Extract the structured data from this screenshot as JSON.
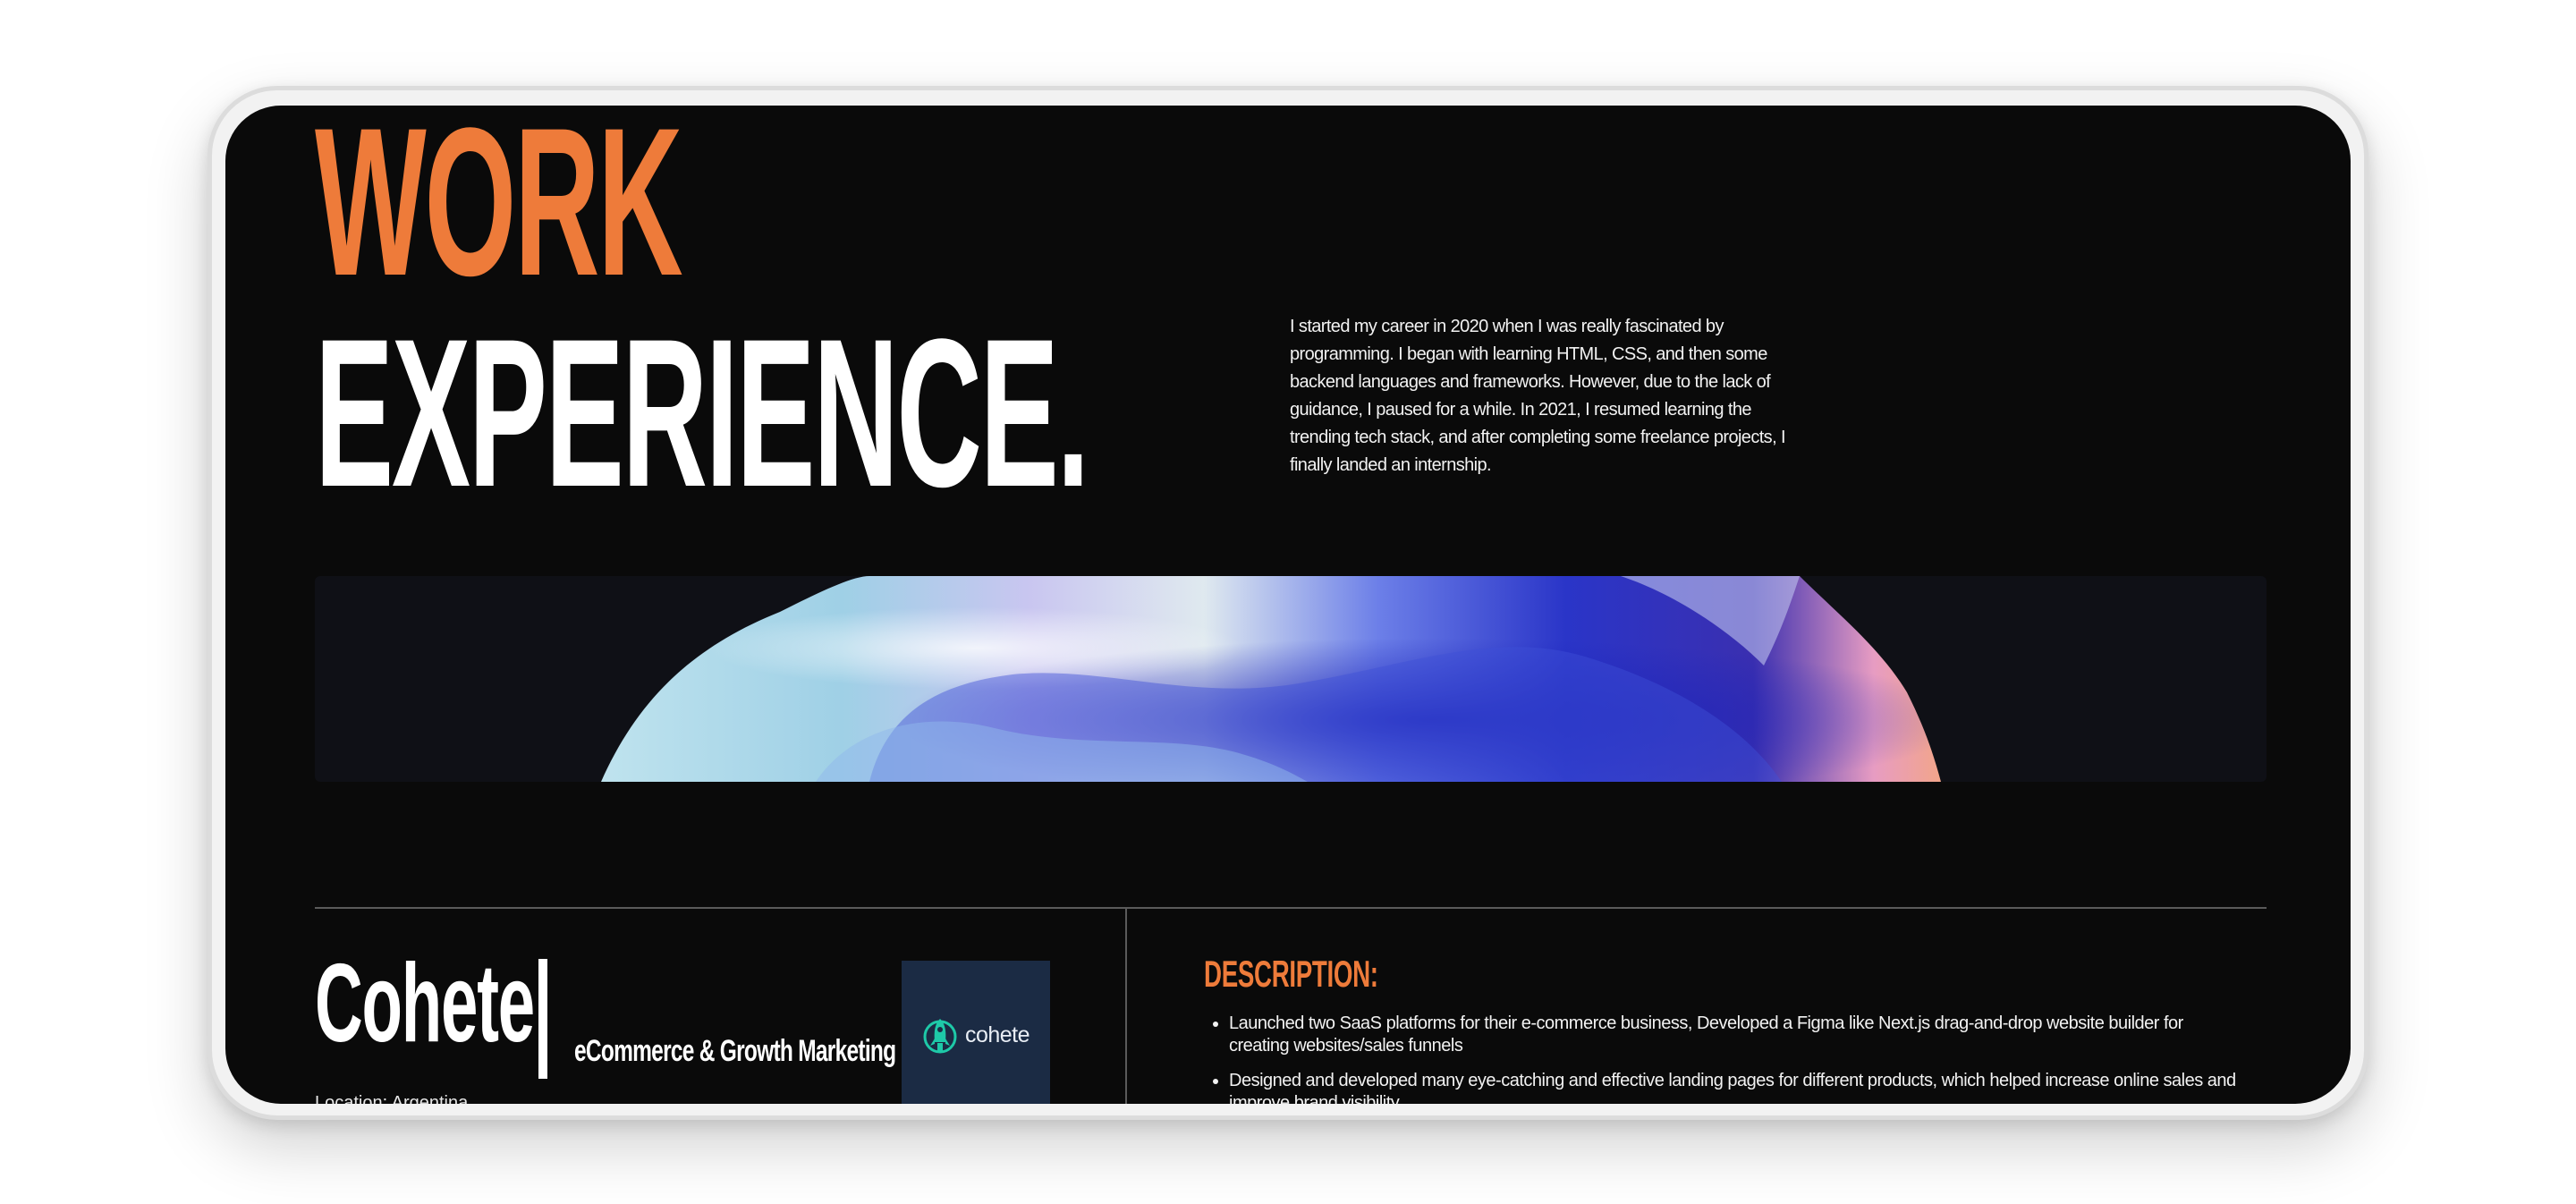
{
  "header": {
    "title_line1": "WORK",
    "title_line2": "EXPERIENCE."
  },
  "intro": {
    "text": "I started my career in 2020 when I was really fascinated by programming. I began with learning HTML, CSS, and then some backend languages and frameworks. However, due to the lack of guidance, I paused for a while. In 2021, I resumed learning the trending tech stack, and after completing some freelance projects, I finally landed an internship."
  },
  "experience": {
    "company": "Cohete",
    "role": "eCommerce & Growth Marketing",
    "location": "Location: Argentina",
    "logo_text": "cohete",
    "description_title": "DESCRIPTION:",
    "description_items": [
      "Launched two SaaS platforms for their e-commerce business, Developed a Figma like Next.js drag-and-drop website builder for creating websites/sales funnels",
      "Designed and developed many eye-catching and effective landing pages for different products, which helped increase online sales and improve brand visibility"
    ]
  },
  "colors": {
    "accent": "#ee7b3a",
    "background": "#0a0a0a",
    "logo_background": "#1b2b44",
    "logo_icon": "#1ec9a8"
  },
  "icons": {
    "logo": "rocket-icon"
  }
}
